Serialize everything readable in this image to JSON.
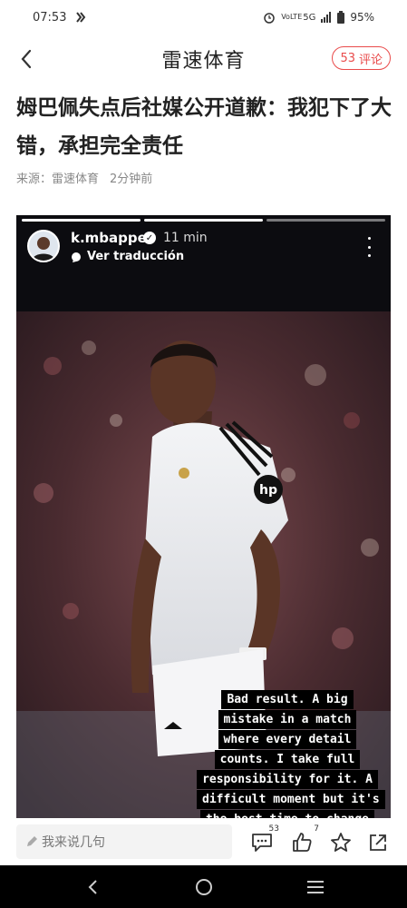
{
  "status_bar": {
    "time": "07:53",
    "network": "5G",
    "volte": "VoLTE",
    "battery": "95%"
  },
  "header": {
    "title": "雷速体育",
    "comment_count": "53",
    "comment_label": "评论"
  },
  "article": {
    "headline": "姆巴佩失点后社媒公开道歉：我犯下了大错，承担完全责任",
    "source": "来源：雷速体育",
    "time_ago": "2分钟前"
  },
  "story": {
    "username": "k.mbappe",
    "time": "11 min",
    "translate": "Ver traducción",
    "caption_lines": [
      "Bad result. A big",
      "mistake in a match",
      "where every detail",
      "counts. I take full",
      "responsibility for it. A",
      "difficult moment but it's",
      "the best time to change"
    ],
    "jersey_sponsor": "hp"
  },
  "bottom_bar": {
    "comment_placeholder": "我来说几句",
    "comments_badge": "53",
    "likes_badge": "7"
  },
  "icons": {
    "back": "chevron-left-icon",
    "comment": "comment-bubble-icon",
    "like": "thumbs-up-icon",
    "favorite": "star-icon",
    "share": "share-icon"
  },
  "colors": {
    "accent": "#e94b4b",
    "story_bg": "#0c0c10"
  }
}
